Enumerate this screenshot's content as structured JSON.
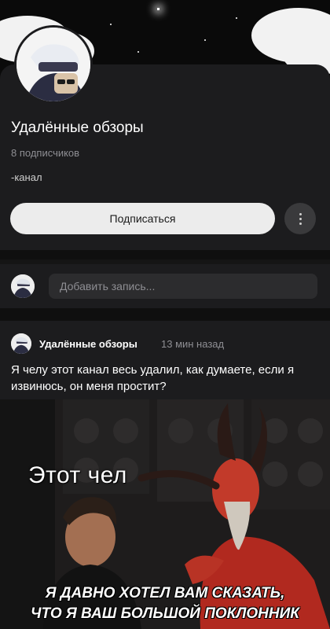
{
  "channel": {
    "name": "Удалённые обзоры",
    "subscribers": "8 подписчиков",
    "description": "-канал",
    "subscribe_label": "Подписаться"
  },
  "composer": {
    "placeholder": "Добавить запись..."
  },
  "post": {
    "author": "Удалённые обзоры",
    "time": "13 мин назад",
    "text": "Я челу этот канал весь удалил, как думаете, если я извинюсь, он меня простит?",
    "image": {
      "caption_top": "Этот чел",
      "caption_bottom_line1": "Я ДАВНО ХОТЕЛ ВАМ СКАЗАТЬ,",
      "caption_bottom_line2": "ЧТО Я ВАШ БОЛЬШОЙ ПОКЛОННИК"
    }
  },
  "icons": {
    "more": "more-vertical-icon"
  },
  "colors": {
    "background": "#151515",
    "card": "#1c1c1e",
    "button": "#ececec",
    "muted_text": "#8e8e93"
  }
}
